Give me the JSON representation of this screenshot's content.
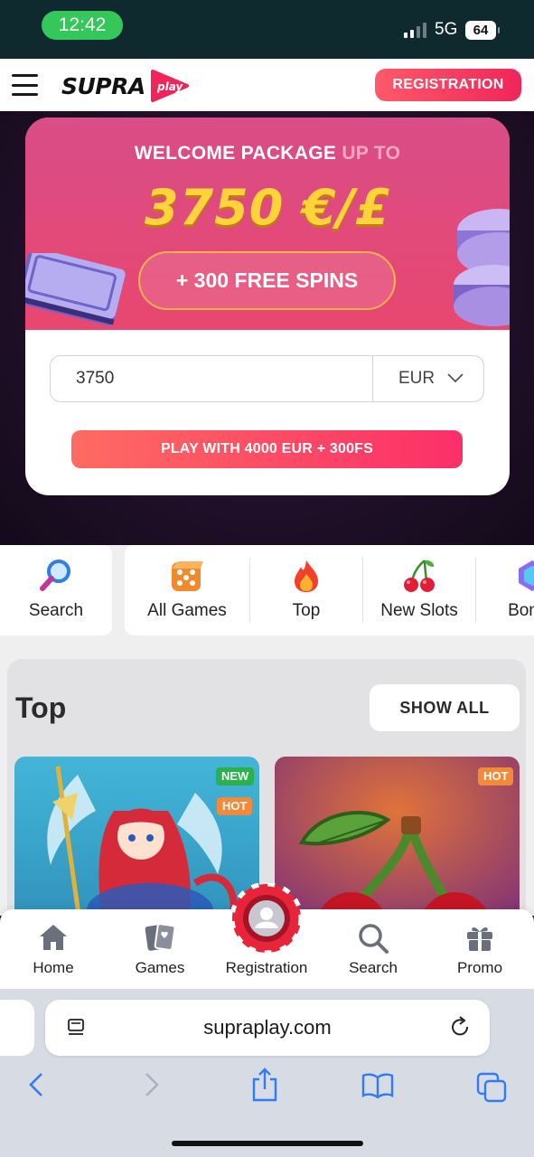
{
  "status_bar": {
    "time": "12:42",
    "network": "5G",
    "battery": "64"
  },
  "header": {
    "logo_text": "SUPRA",
    "logo_mark_text": "play",
    "registration_label": "REGISTRATION"
  },
  "promo": {
    "welcome_text": "WELCOME PACKAGE",
    "welcome_suffix": "UP TO",
    "amount_text": "3750 €/£",
    "free_spins": "+ 300 FREE SPINS",
    "amount_value": "3750",
    "currency": "EUR",
    "play_label": "PLAY WITH 4000 EUR + 300FS"
  },
  "categories": [
    {
      "label": "Search",
      "icon": "magnifier-icon"
    },
    {
      "label": "All Games",
      "icon": "dice-icon"
    },
    {
      "label": "Top",
      "icon": "fire-icon"
    },
    {
      "label": "New Slots",
      "icon": "cherries-icon"
    },
    {
      "label": "Bonus",
      "icon": "bonus-icon"
    }
  ],
  "top_section": {
    "title": "Top",
    "show_all_label": "SHOW ALL",
    "games": [
      {
        "badges": [
          "NEW",
          "HOT"
        ],
        "art": "fantasy-heroine"
      },
      {
        "badges": [
          "HOT"
        ],
        "art": "cherries"
      }
    ]
  },
  "bottom_nav": [
    {
      "label": "Home",
      "icon": "home-icon"
    },
    {
      "label": "Games",
      "icon": "cards-icon"
    },
    {
      "label": "Registration",
      "icon": "user-chip-icon"
    },
    {
      "label": "Search",
      "icon": "search-icon"
    },
    {
      "label": "Promo",
      "icon": "gift-icon"
    }
  ],
  "browser": {
    "url": "supraplay.com"
  },
  "colors": {
    "accent": "#f0255a",
    "promo_gold": "#ffd43a",
    "status_green": "#34c759"
  }
}
